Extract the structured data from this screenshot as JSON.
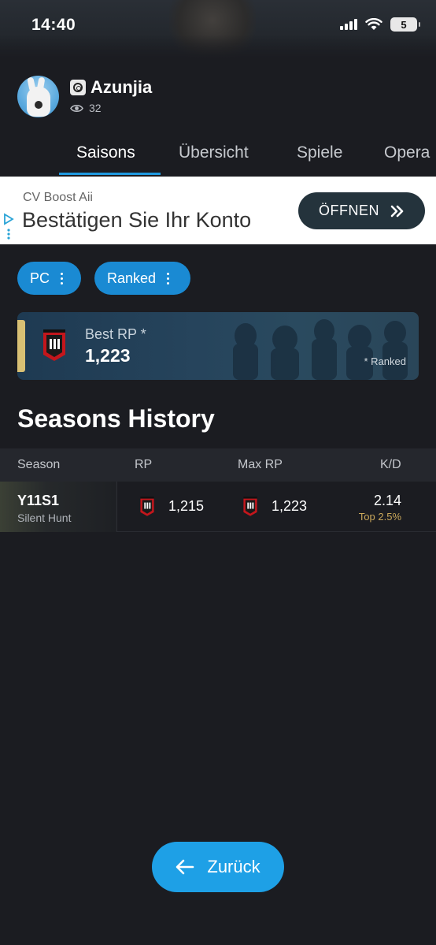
{
  "status_bar": {
    "time": "14:40",
    "battery": "5"
  },
  "profile": {
    "name": "Azunjia",
    "views": "32"
  },
  "tabs": [
    {
      "label": "Saisons",
      "active": true
    },
    {
      "label": "Übersicht",
      "active": false
    },
    {
      "label": "Spiele",
      "active": false
    },
    {
      "label": "Opera",
      "active": false
    }
  ],
  "ad": {
    "brand": "CV Boost Aii",
    "title": "Bestätigen Sie Ihr Konto",
    "button_label": "ÖFFNEN"
  },
  "filters": {
    "platform": "PC",
    "mode": "Ranked"
  },
  "best_rp": {
    "label": "Best RP *",
    "value": "1,223",
    "note": "* Ranked"
  },
  "seasons_history": {
    "title": "Seasons History",
    "columns": {
      "season": "Season",
      "rp": "RP",
      "max_rp": "Max RP",
      "kd": "K/D"
    },
    "rows": [
      {
        "code": "Y11S1",
        "name": "Silent Hunt",
        "rp": "1,215",
        "max_rp": "1,223",
        "kd": "2.14",
        "kd_top": "Top 2.5%"
      }
    ]
  },
  "back_button": {
    "label": "Zurück"
  },
  "colors": {
    "accent": "#1ea0e6",
    "background": "#1b1c21",
    "rank_red": "#c4161c",
    "highlight_gold": "#c9a75a"
  }
}
